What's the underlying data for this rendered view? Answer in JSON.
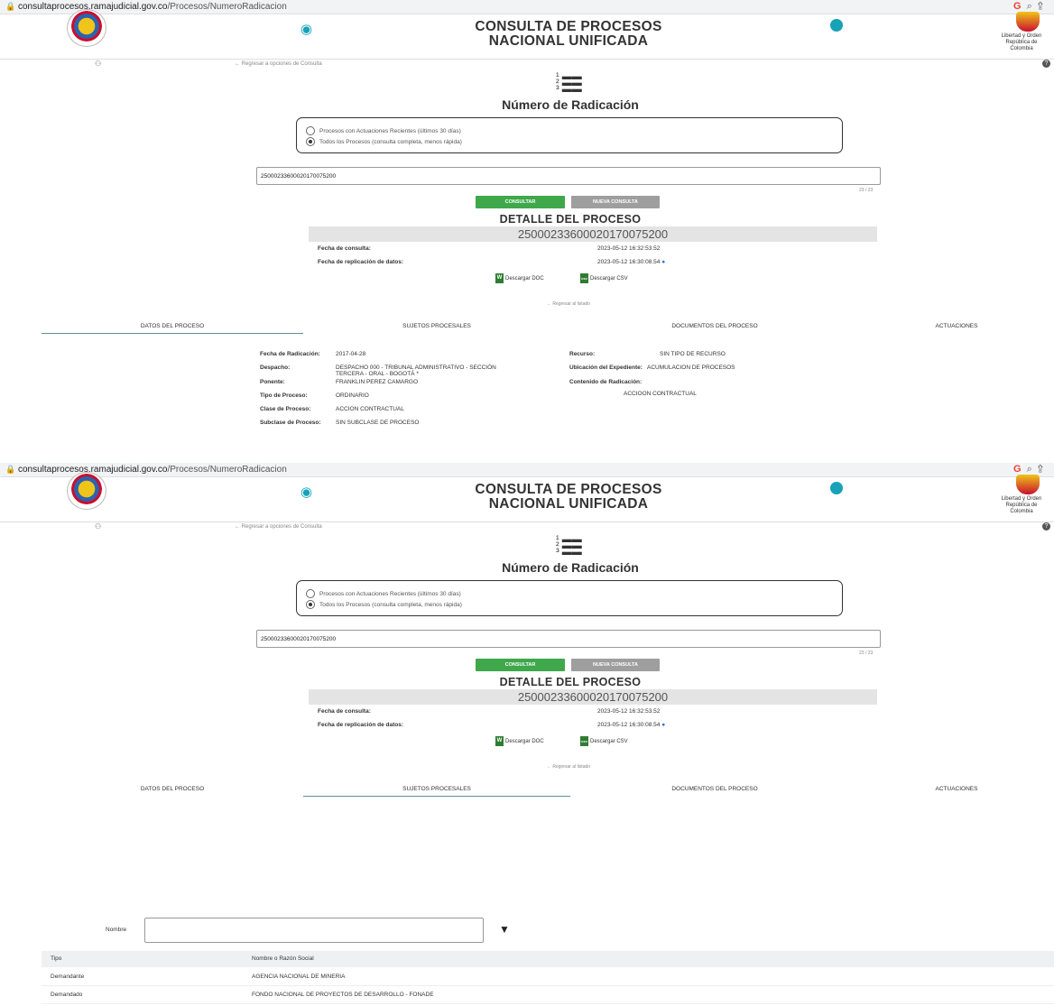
{
  "browser": {
    "url_domain": "consultaprocesos.ramajudicial.gov.co",
    "url_path": "/Procesos/NumeroRadicacion"
  },
  "header": {
    "title_line1": "CONSULTA DE PROCESOS",
    "title_line2": "NACIONAL UNIFICADA",
    "crest_caption_1": "Libertad y Orden",
    "crest_caption_2": "República de Colombia"
  },
  "nav": {
    "back_options": "Regresar a opciones de Consulta"
  },
  "page": {
    "heading": "Número de Radicación"
  },
  "search": {
    "option_recent": "Procesos con Actuaciones Recientes (últimos 30 días)",
    "option_all": "Todos los Procesos (consulta completa, menos rápida)",
    "selected_option": "all",
    "radicacion_value": "25000233600020170075200",
    "char_counter": "23 / 23",
    "consultar_label": "CONSULTAR",
    "nueva_label": "NUEVA CONSULTA"
  },
  "detail": {
    "heading": "DETALLE DEL PROCESO",
    "number": "25000233600020170075200",
    "fecha_consulta_label": "Fecha de consulta:",
    "fecha_consulta_value": "2023-05-12 16:32:53.52",
    "fecha_replicacion_label": "Fecha de replicación de datos:",
    "fecha_replicacion_value": "2023-05-12 16:30:08.54",
    "download_doc": "Descargar DOC",
    "download_csv": "Descargar CSV",
    "doc_icon": "W",
    "csv_icon": "csv",
    "back_list": "Regresar al listado"
  },
  "tabs": {
    "datos": "DATOS DEL PROCESO",
    "sujetos": "SUJETOS PROCESALES",
    "documentos": "DOCUMENTOS DEL PROCESO",
    "actuaciones": "ACTUACIONES"
  },
  "datos_proceso": {
    "fecha_radicacion_label": "Fecha de Radicación:",
    "fecha_radicacion": "2017-04-28",
    "despacho_label": "Despacho:",
    "despacho_line1": "DESPACHO 000 - TRIBUNAL ADMINISTRATIVO - SECCIÓN",
    "despacho_line2": "TERCERA - ORAL - BOGOTÁ *",
    "ponente_label": "Ponente:",
    "ponente": "FRANKLIN PEREZ CAMARGO",
    "tipo_label": "Tipo de Proceso:",
    "tipo": "ORDINARIO",
    "clase_label": "Clase de Proceso:",
    "clase": "ACCION CONTRACTUAL",
    "subclase_label": "Subclase de Proceso:",
    "subclase": "SIN SUBCLASE DE PROCESO",
    "recurso_label": "Recurso:",
    "recurso": "SIN TIPO DE RECURSO",
    "ubicacion_label": "Ubicación del Expediente:",
    "ubicacion": "ACUMULACION DE PROCESOS",
    "contenido_label": "Contenido de Radicación:",
    "contenido": "ACCIOON CONTRACTUAL"
  },
  "sujetos": {
    "filter_label": "Nombre",
    "filter_value": "",
    "col_tipo": "Tipo",
    "col_nombre": "Nombre o Razón Social",
    "rows": [
      {
        "tipo": "Demandante",
        "nombre": "AGENCIA NACIONAL DE MINERIA"
      },
      {
        "tipo": "Demandado",
        "nombre": "FONDO NACIONAL DE PROYECTOS DE DESARROLLO - FONADE"
      }
    ]
  },
  "colors": {
    "accent": "#17a2b8",
    "consultar": "#3ea84a",
    "nueva": "#9e9e9e",
    "doc_file": "#2e7d32"
  }
}
